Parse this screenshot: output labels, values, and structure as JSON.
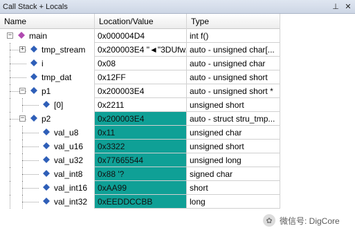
{
  "window": {
    "title": "Call Stack + Locals",
    "pin_glyph": "⊥",
    "close_glyph": "✕"
  },
  "columns": {
    "name": "Name",
    "location": "Location/Value",
    "type": "Type"
  },
  "rows": [
    {
      "name": "main",
      "location": "0x000004D4",
      "type": "int f()",
      "changed": false
    },
    {
      "name": "tmp_stream",
      "location": "0x200003E4 \"◄\"3DUfw...",
      "type": "auto - unsigned char[...",
      "changed": false
    },
    {
      "name": "i",
      "location": "0x08",
      "type": "auto - unsigned char",
      "changed": false
    },
    {
      "name": "tmp_dat",
      "location": "0x12FF",
      "type": "auto - unsigned short",
      "changed": false
    },
    {
      "name": "p1",
      "location": "0x200003E4",
      "type": "auto - unsigned short *",
      "changed": false
    },
    {
      "name": "[0]",
      "location": "0x2211",
      "type": "unsigned short",
      "changed": false
    },
    {
      "name": "p2",
      "location": "0x200003E4",
      "type": "auto - struct stru_tmp...",
      "changed": true
    },
    {
      "name": "val_u8",
      "location": "0x11",
      "type": "unsigned char",
      "changed": true
    },
    {
      "name": "val_u16",
      "location": "0x3322",
      "type": "unsigned short",
      "changed": true
    },
    {
      "name": "val_u32",
      "location": "0x77665544",
      "type": "unsigned long",
      "changed": true
    },
    {
      "name": "val_int8",
      "location": "0x88 '?",
      "type": "signed char",
      "changed": true
    },
    {
      "name": "val_int16",
      "location": "0xAA99",
      "type": "short",
      "changed": true
    },
    {
      "name": "val_int32",
      "location": "0xEEDDCCBB",
      "type": "long",
      "changed": true
    }
  ],
  "expanders": {
    "collapse": "−",
    "expand": "+"
  },
  "watermark": {
    "text": "微信号: DigCore",
    "icon": "wechat-icon"
  },
  "colors": {
    "changed_bg": "#0fa096",
    "function_icon": "#b04ab0",
    "variable_icon": "#2f5fb8"
  }
}
